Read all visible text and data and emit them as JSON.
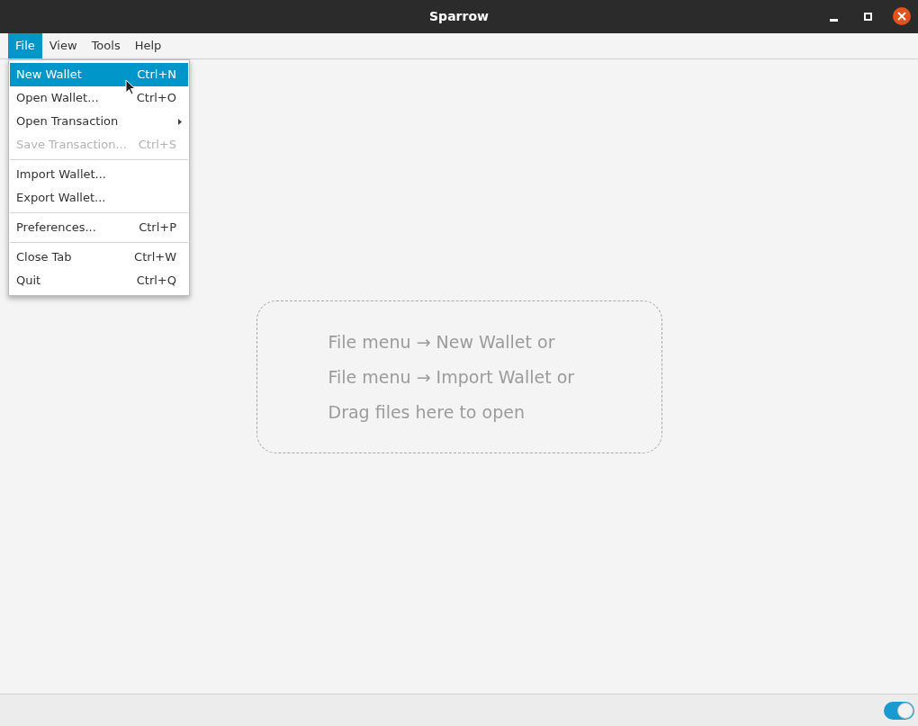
{
  "window": {
    "title": "Sparrow"
  },
  "menubar": [
    {
      "label": "File",
      "selected": true
    },
    {
      "label": "View",
      "selected": false
    },
    {
      "label": "Tools",
      "selected": false
    },
    {
      "label": "Help",
      "selected": false
    }
  ],
  "file_menu": [
    {
      "kind": "item",
      "label": "New Wallet",
      "shortcut": "Ctrl+N",
      "selected": true,
      "disabled": false,
      "submenu": false
    },
    {
      "kind": "item",
      "label": "Open Wallet...",
      "shortcut": "Ctrl+O",
      "selected": false,
      "disabled": false,
      "submenu": false
    },
    {
      "kind": "item",
      "label": "Open Transaction",
      "selected": false,
      "disabled": false,
      "submenu": true
    },
    {
      "kind": "item",
      "label": "Save Transaction...",
      "shortcut": "Ctrl+S",
      "selected": false,
      "disabled": true,
      "submenu": false
    },
    {
      "kind": "separator"
    },
    {
      "kind": "item",
      "label": "Import Wallet...",
      "selected": false,
      "disabled": false,
      "submenu": false
    },
    {
      "kind": "item",
      "label": "Export Wallet...",
      "selected": false,
      "disabled": false,
      "submenu": false
    },
    {
      "kind": "separator"
    },
    {
      "kind": "item",
      "label": "Preferences...",
      "shortcut": "Ctrl+P",
      "selected": false,
      "disabled": false,
      "submenu": false
    },
    {
      "kind": "separator"
    },
    {
      "kind": "item",
      "label": "Close Tab",
      "shortcut": "Ctrl+W",
      "selected": false,
      "disabled": false,
      "submenu": false
    },
    {
      "kind": "item",
      "label": "Quit",
      "shortcut": "Ctrl+Q",
      "selected": false,
      "disabled": false,
      "submenu": false
    }
  ],
  "drop_zone": {
    "lines": [
      "File menu → New Wallet or",
      "File menu → Import Wallet or",
      "Drag files here to open"
    ]
  },
  "status_bar": {
    "toggle": {
      "on": true
    }
  }
}
